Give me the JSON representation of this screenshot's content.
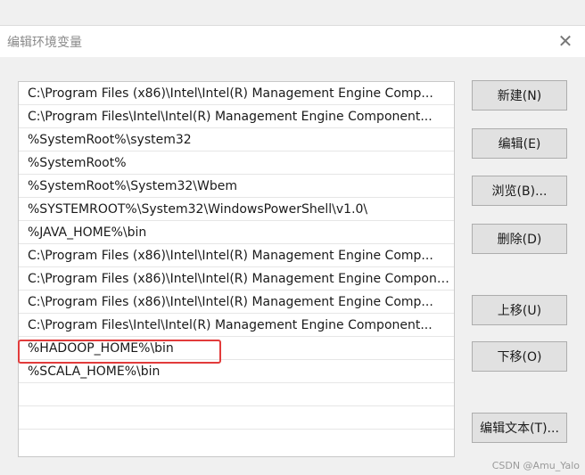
{
  "dialog": {
    "title": "编辑环境变量",
    "close_glyph": "✕"
  },
  "path_list": [
    "C:\\Program Files (x86)\\Intel\\Intel(R) Management Engine Comp...",
    "C:\\Program Files\\Intel\\Intel(R) Management Engine Component...",
    "%SystemRoot%\\system32",
    "%SystemRoot%",
    "%SystemRoot%\\System32\\Wbem",
    "%SYSTEMROOT%\\System32\\WindowsPowerShell\\v1.0\\",
    "%JAVA_HOME%\\bin",
    "C:\\Program Files (x86)\\Intel\\Intel(R) Management Engine Comp...",
    "C:\\Program Files (x86)\\Intel\\Intel(R) Management Engine Component...",
    "C:\\Program Files (x86)\\Intel\\Intel(R) Management Engine Comp...",
    "C:\\Program Files\\Intel\\Intel(R) Management Engine Component...",
    "%HADOOP_HOME%\\bin",
    "%SCALA_HOME%\\bin"
  ],
  "buttons": {
    "new": "新建(N)",
    "edit": "编辑(E)",
    "browse": "浏览(B)...",
    "delete": "删除(D)",
    "move_up": "上移(U)",
    "move_down": "下移(O)",
    "edit_text": "编辑文本(T)..."
  },
  "highlight_color": "#e23b3b",
  "watermark": "CSDN @Amu_Yalo"
}
